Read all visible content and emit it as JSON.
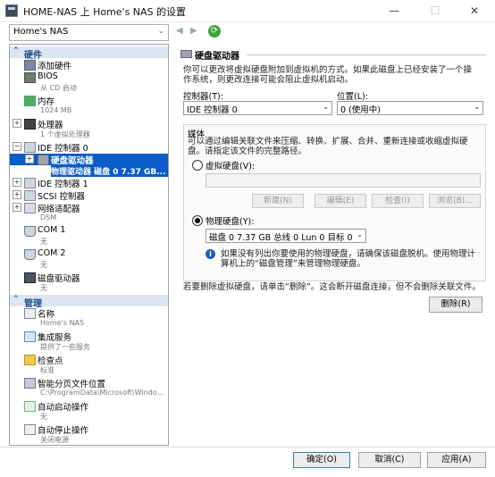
{
  "window": {
    "title": "HOME-NAS 上 Home's NAS 的设置",
    "controls": {
      "minimize": "—",
      "maximize": "☐",
      "close": "✕"
    }
  },
  "toolbar": {
    "vm_selected": "Home's NAS",
    "back_glyph": "◀",
    "forward_glyph": "▶",
    "refresh_glyph": "⟳"
  },
  "sidebar": {
    "hardware": {
      "header": "硬件",
      "items": [
        {
          "label": "添加硬件",
          "sub": ""
        },
        {
          "label": "BIOS",
          "sub": "从 CD 启动"
        },
        {
          "label": "内存",
          "sub": "1024 MB"
        },
        {
          "label": "处理器",
          "sub": "1 个虚拟处理器"
        },
        {
          "label": "IDE 控制器 0",
          "sub": ""
        },
        {
          "label": "硬盘驱动器",
          "sub": "物理驱动器 磁盘 0 7.37 GB..."
        },
        {
          "label": "IDE 控制器 1",
          "sub": ""
        },
        {
          "label": "SCSI 控制器",
          "sub": ""
        },
        {
          "label": "网络适配器",
          "sub": "DSM"
        },
        {
          "label": "COM 1",
          "sub": "无"
        },
        {
          "label": "COM 2",
          "sub": "无"
        },
        {
          "label": "磁盘驱动器",
          "sub": "无"
        }
      ]
    },
    "management": {
      "header": "管理",
      "items": [
        {
          "label": "名称",
          "sub": "Home's NAS"
        },
        {
          "label": "集成服务",
          "sub": "提供了一些服务"
        },
        {
          "label": "检查点",
          "sub": "标准"
        },
        {
          "label": "智能分页文件位置",
          "sub": "C:\\ProgramData\\Microsoft\\Windo..."
        },
        {
          "label": "自动启动操作",
          "sub": "无"
        },
        {
          "label": "自动停止操作",
          "sub": "关闭电源"
        }
      ]
    }
  },
  "panel": {
    "title": "硬盘驱动器",
    "intro": "你可以更改将虚拟硬盘附加到虚拟机的方式。如果此磁盘上已经安装了一个操作系统，则更改连接可能会阻止虚拟机启动。",
    "controller_label": "控制器(T):",
    "controller_value": "IDE 控制器 0",
    "location_label": "位置(L):",
    "location_value": "0 (使用中)",
    "media": {
      "label": "媒体",
      "desc": "可以通过编辑关联文件来压缩、转换、扩展、合并、重新连接或收缩虚拟硬盘。请指定该文件的完整路径。",
      "vhd_label": "虚拟硬盘(V):",
      "vhd_path": "",
      "buttons": {
        "new": "新建(N)",
        "edit": "编辑(E)",
        "inspect": "检查(I)",
        "browse": "浏览(B)..."
      },
      "physical_label": "物理硬盘(Y):",
      "physical_value": "磁盘 0 7.37 GB 总线 0 Lun 0 目标 0",
      "info": "如果没有列出你要使用的物理硬盘，请确保该磁盘脱机。使用物理计算机上的“磁盘管理”来管理物理硬盘。"
    },
    "remove_desc": "若要删除虚拟硬盘，请单击“删除”。这会断开磁盘连接，但不会删除关联文件。",
    "remove_button": "删除(R)"
  },
  "footer": {
    "ok": "确定(O)",
    "cancel": "取消(C)",
    "apply": "应用(A)"
  }
}
